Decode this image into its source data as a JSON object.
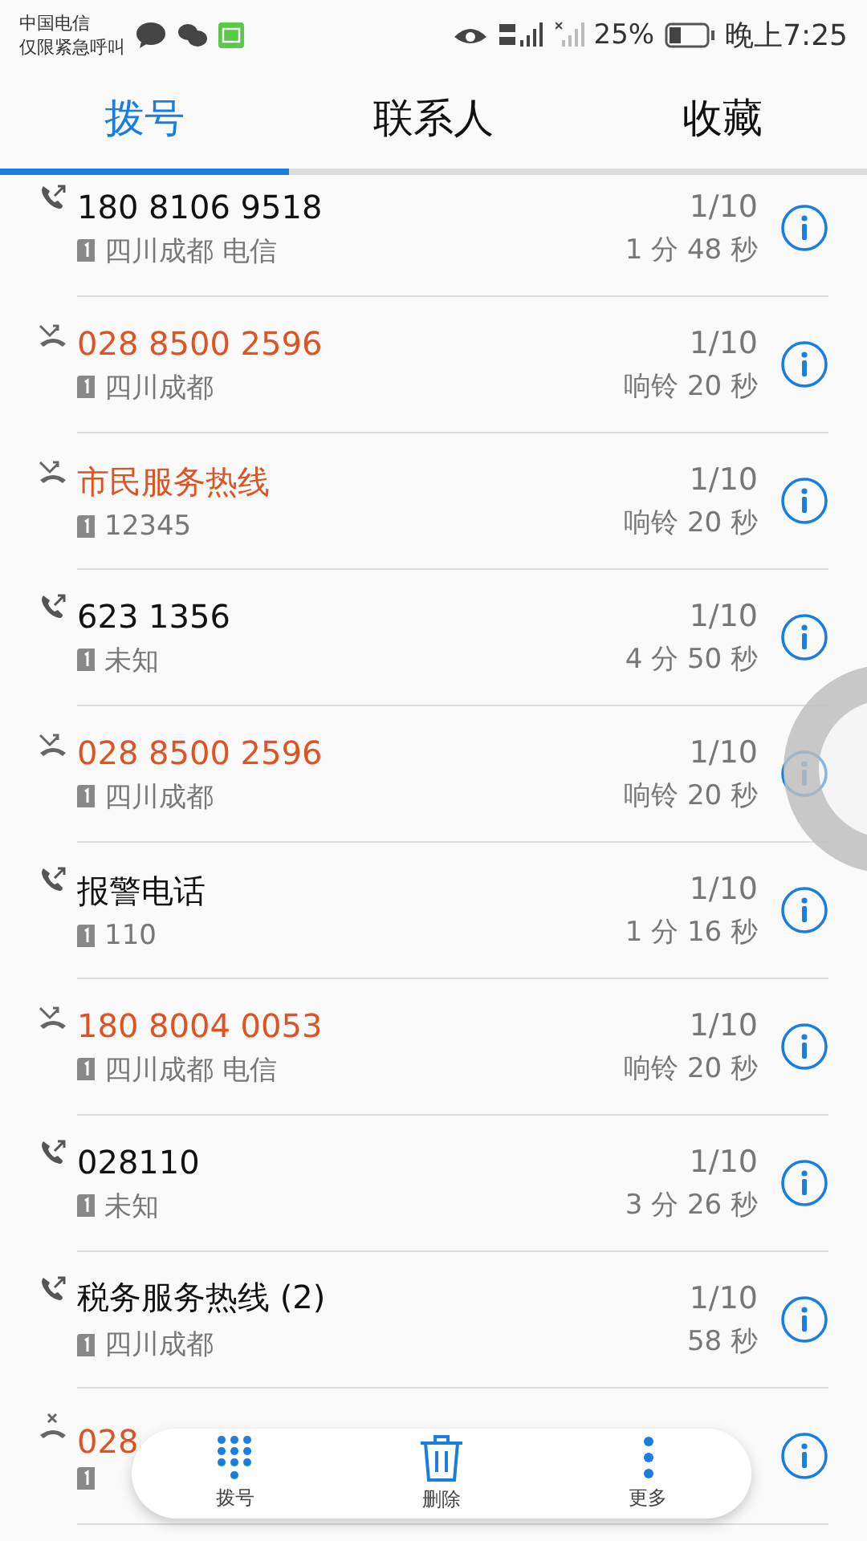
{
  "status_bar": {
    "carrier": "中国电信",
    "emergency": "仅限紧急呼叫",
    "battery_text": "25%",
    "time": "晚上7:25"
  },
  "tabs": [
    {
      "label": "拨号",
      "selected": true
    },
    {
      "label": "联系人",
      "selected": false
    },
    {
      "label": "收藏",
      "selected": false
    }
  ],
  "calls": [
    {
      "kind": "outgoing",
      "name": "180 8106 9518",
      "location": "四川成都 电信",
      "date": "1/10",
      "detail": "1 分 48 秒"
    },
    {
      "kind": "missed",
      "name": "028 8500 2596",
      "location": "四川成都",
      "date": "1/10",
      "detail": "响铃 20 秒"
    },
    {
      "kind": "missed",
      "name": "市民服务热线",
      "location": "12345",
      "date": "1/10",
      "detail": "响铃 20 秒"
    },
    {
      "kind": "outgoing",
      "name": "623 1356",
      "location": "未知",
      "date": "1/10",
      "detail": "4 分 50 秒"
    },
    {
      "kind": "missed",
      "name": "028 8500 2596",
      "location": "四川成都",
      "date": "1/10",
      "detail": "响铃 20 秒"
    },
    {
      "kind": "outgoing",
      "name": "报警电话",
      "location": "110",
      "date": "1/10",
      "detail": "1 分 16 秒"
    },
    {
      "kind": "missed",
      "name": "180 8004 0053",
      "location": "四川成都 电信",
      "date": "1/10",
      "detail": "响铃 20 秒"
    },
    {
      "kind": "outgoing",
      "name": "028110",
      "location": "未知",
      "date": "1/10",
      "detail": "3 分 26 秒"
    },
    {
      "kind": "outgoing",
      "name": "税务服务热线 (2)",
      "location": "四川成都",
      "date": "1/10",
      "detail": "58 秒"
    },
    {
      "kind": "rejected",
      "name": "028"
    }
  ],
  "bottom_bar": [
    {
      "kind": "dialpad",
      "label": "拨号"
    },
    {
      "kind": "delete",
      "label": "删除"
    },
    {
      "kind": "more",
      "label": "更多"
    }
  ]
}
